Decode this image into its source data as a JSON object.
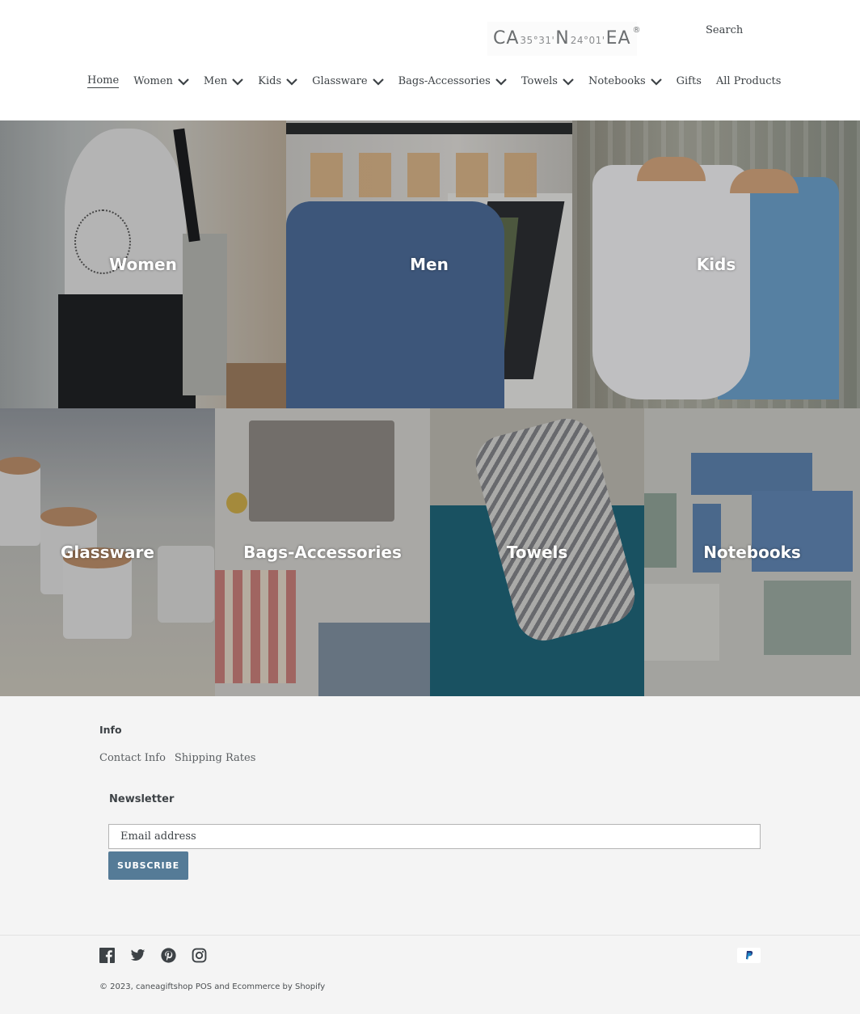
{
  "header": {
    "logo": {
      "part1": "CA",
      "coord1": "35°31'",
      "part2": "N",
      "coord2": "24°01'",
      "part3": "EA",
      "registered": "®"
    },
    "search_label": "Search"
  },
  "nav": {
    "items": [
      {
        "label": "Home",
        "active": true,
        "has_dropdown": false
      },
      {
        "label": "Women",
        "has_dropdown": true
      },
      {
        "label": "Men",
        "has_dropdown": true
      },
      {
        "label": "Kids",
        "has_dropdown": true
      },
      {
        "label": "Glassware",
        "has_dropdown": true
      },
      {
        "label": "Bags-Accessories",
        "has_dropdown": true
      },
      {
        "label": "Towels",
        "has_dropdown": true
      },
      {
        "label": "Notebooks",
        "has_dropdown": true
      },
      {
        "label": "Gifts",
        "has_dropdown": false
      },
      {
        "label": "All Products",
        "has_dropdown": false
      }
    ]
  },
  "collections": {
    "row1": [
      {
        "label": "Women"
      },
      {
        "label": "Men"
      },
      {
        "label": "Kids"
      }
    ],
    "row2": [
      {
        "label": "Glassware"
      },
      {
        "label": "Bags-Accessories"
      },
      {
        "label": "Towels"
      },
      {
        "label": "Notebooks"
      }
    ]
  },
  "footer": {
    "info_title": "Info",
    "links": [
      "Contact Info",
      "Shipping Rates"
    ],
    "newsletter_title": "Newsletter",
    "email_placeholder": "Email address",
    "subscribe_label": "SUBSCRIBE",
    "social_icons": [
      "facebook-icon",
      "twitter-icon",
      "pinterest-icon",
      "instagram-icon"
    ],
    "payment_icons": [
      "paypal-icon"
    ],
    "copyright_prefix": "© 2023, ",
    "shop_name": "caneagiftshop",
    "pos_link": "POS",
    "and_text": " and ",
    "ecommerce_link": "Ecommerce by Shopify"
  },
  "colors": {
    "accent": "#557b97",
    "text": "#3d4246",
    "footer_bg": "#f4f4f4"
  }
}
